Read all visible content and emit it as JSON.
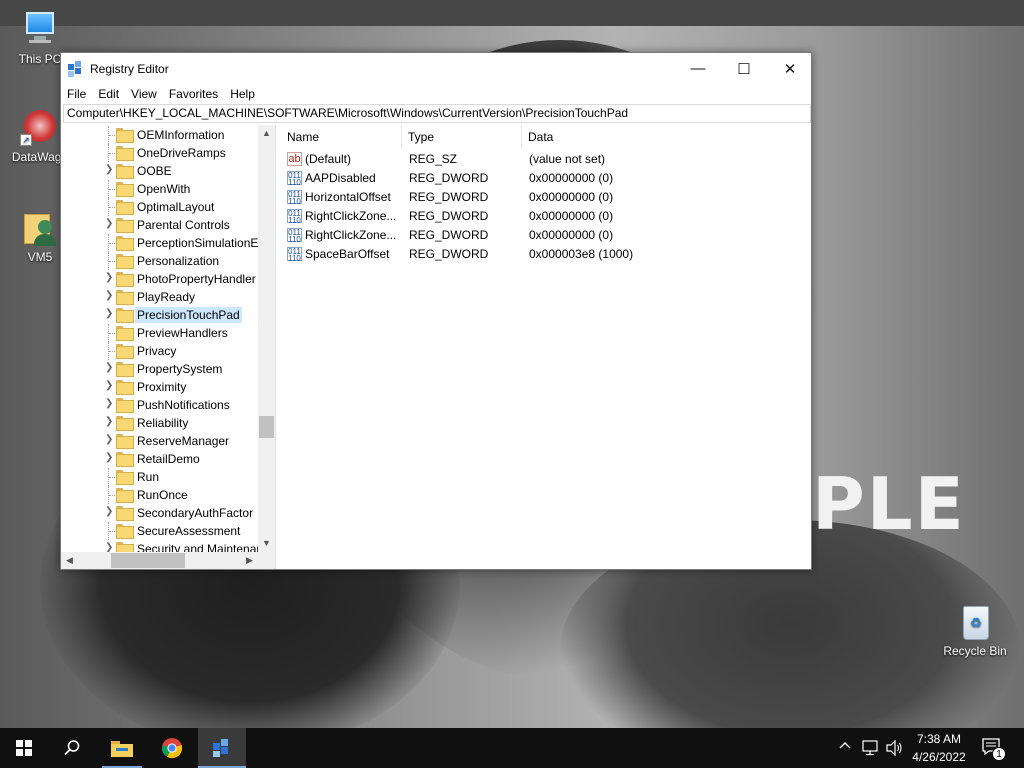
{
  "desktop": {
    "icons": [
      {
        "label": "This PC",
        "icon": "computer-icon"
      },
      {
        "label": "DataWago",
        "icon": "datawago-icon"
      },
      {
        "label": "VM5",
        "icon": "user-folder-icon"
      },
      {
        "label": "Recycle Bin",
        "icon": "recycle-bin-icon"
      }
    ],
    "wallpaper_visible_text": "PLE"
  },
  "window": {
    "title": "Registry Editor",
    "controls": {
      "minimize": "—",
      "maximize": "☐",
      "close": "✕"
    },
    "menu": [
      "File",
      "Edit",
      "View",
      "Favorites",
      "Help"
    ],
    "address": "Computer\\HKEY_LOCAL_MACHINE\\SOFTWARE\\Microsoft\\Windows\\CurrentVersion\\PrecisionTouchPad",
    "tree": {
      "items": [
        {
          "label": "OEMInformation",
          "expandable": false
        },
        {
          "label": "OneDriveRamps",
          "expandable": false
        },
        {
          "label": "OOBE",
          "expandable": true
        },
        {
          "label": "OpenWith",
          "expandable": false
        },
        {
          "label": "OptimalLayout",
          "expandable": false
        },
        {
          "label": "Parental Controls",
          "expandable": true
        },
        {
          "label": "PerceptionSimulationE",
          "expandable": false
        },
        {
          "label": "Personalization",
          "expandable": false
        },
        {
          "label": "PhotoPropertyHandler",
          "expandable": true
        },
        {
          "label": "PlayReady",
          "expandable": true
        },
        {
          "label": "PrecisionTouchPad",
          "expandable": true,
          "selected": true
        },
        {
          "label": "PreviewHandlers",
          "expandable": false
        },
        {
          "label": "Privacy",
          "expandable": false
        },
        {
          "label": "PropertySystem",
          "expandable": true
        },
        {
          "label": "Proximity",
          "expandable": true
        },
        {
          "label": "PushNotifications",
          "expandable": true
        },
        {
          "label": "Reliability",
          "expandable": true
        },
        {
          "label": "ReserveManager",
          "expandable": true
        },
        {
          "label": "RetailDemo",
          "expandable": true
        },
        {
          "label": "Run",
          "expandable": false
        },
        {
          "label": "RunOnce",
          "expandable": false
        },
        {
          "label": "SecondaryAuthFactor",
          "expandable": true
        },
        {
          "label": "SecureAssessment",
          "expandable": false
        },
        {
          "label": "Security and Maintenar",
          "expandable": true
        }
      ]
    },
    "columns": {
      "name": "Name",
      "type": "Type",
      "data": "Data"
    },
    "values": [
      {
        "icon": "string-value-icon",
        "icon_glyph": "ab",
        "name": "(Default)",
        "type": "REG_SZ",
        "data": "(value not set)"
      },
      {
        "icon": "binary-value-icon",
        "icon_glyph": "011 110",
        "name": "AAPDisabled",
        "type": "REG_DWORD",
        "data": "0x00000000 (0)"
      },
      {
        "icon": "binary-value-icon",
        "icon_glyph": "011 110",
        "name": "HorizontalOffset",
        "type": "REG_DWORD",
        "data": "0x00000000 (0)"
      },
      {
        "icon": "binary-value-icon",
        "icon_glyph": "011 110",
        "name": "RightClickZone...",
        "type": "REG_DWORD",
        "data": "0x00000000 (0)"
      },
      {
        "icon": "binary-value-icon",
        "icon_glyph": "011 110",
        "name": "RightClickZone...",
        "type": "REG_DWORD",
        "data": "0x00000000 (0)"
      },
      {
        "icon": "binary-value-icon",
        "icon_glyph": "011 110",
        "name": "SpaceBarOffset",
        "type": "REG_DWORD",
        "data": "0x000003e8 (1000)"
      }
    ]
  },
  "taskbar": {
    "buttons": [
      "start-button",
      "search-button",
      "file-explorer-button",
      "chrome-button",
      "regedit-button"
    ],
    "clock": {
      "time": "7:38 AM",
      "date": "4/26/2022"
    },
    "notification_count": "1"
  },
  "colors": {
    "taskbar": "#101010",
    "selection": "#cce8ff",
    "window_border": "#7a7a7a"
  }
}
